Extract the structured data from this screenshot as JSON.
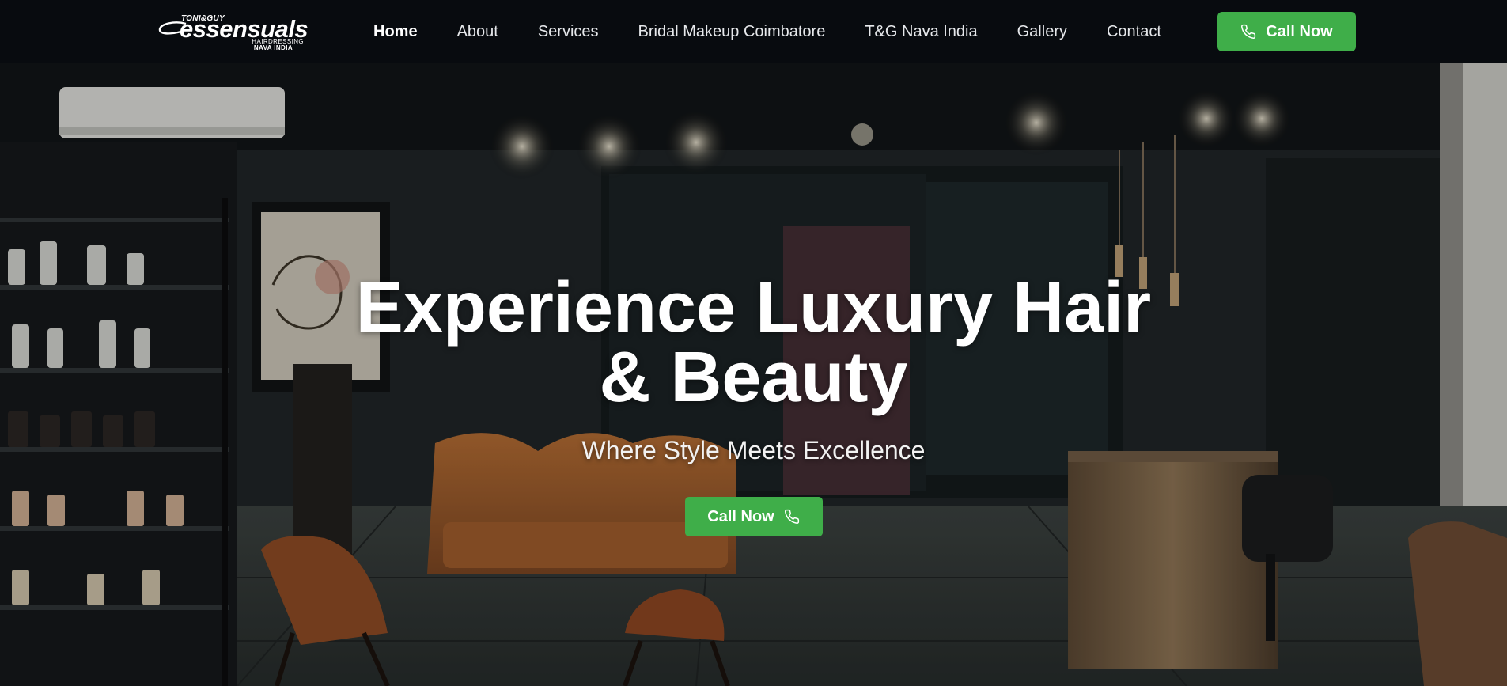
{
  "brand": {
    "logo_top": "TONI&GUY",
    "logo_main": "essensuals",
    "logo_sub": "HAIRDRESSING",
    "logo_sub2": "NAVA INDIA"
  },
  "nav": {
    "items": [
      {
        "label": "Home",
        "active": true
      },
      {
        "label": "About",
        "active": false
      },
      {
        "label": "Services",
        "active": false
      },
      {
        "label": "Bridal Makeup Coimbatore",
        "active": false
      },
      {
        "label": "T&G Nava India",
        "active": false
      },
      {
        "label": "Gallery",
        "active": false
      },
      {
        "label": "Contact",
        "active": false
      }
    ],
    "cta_label": "Call Now",
    "cta_icon": "phone-icon"
  },
  "hero": {
    "title_line1": "Experience Luxury Hair",
    "title_line2": "& Beauty",
    "subtitle": "Where Style Meets Excellence",
    "cta_label": "Call Now",
    "cta_icon": "phone-icon",
    "background": "salon-reception-photo"
  },
  "colors": {
    "header_bg": "#080b0f",
    "accent_green": "#3fae49",
    "text_white": "#ffffff"
  }
}
